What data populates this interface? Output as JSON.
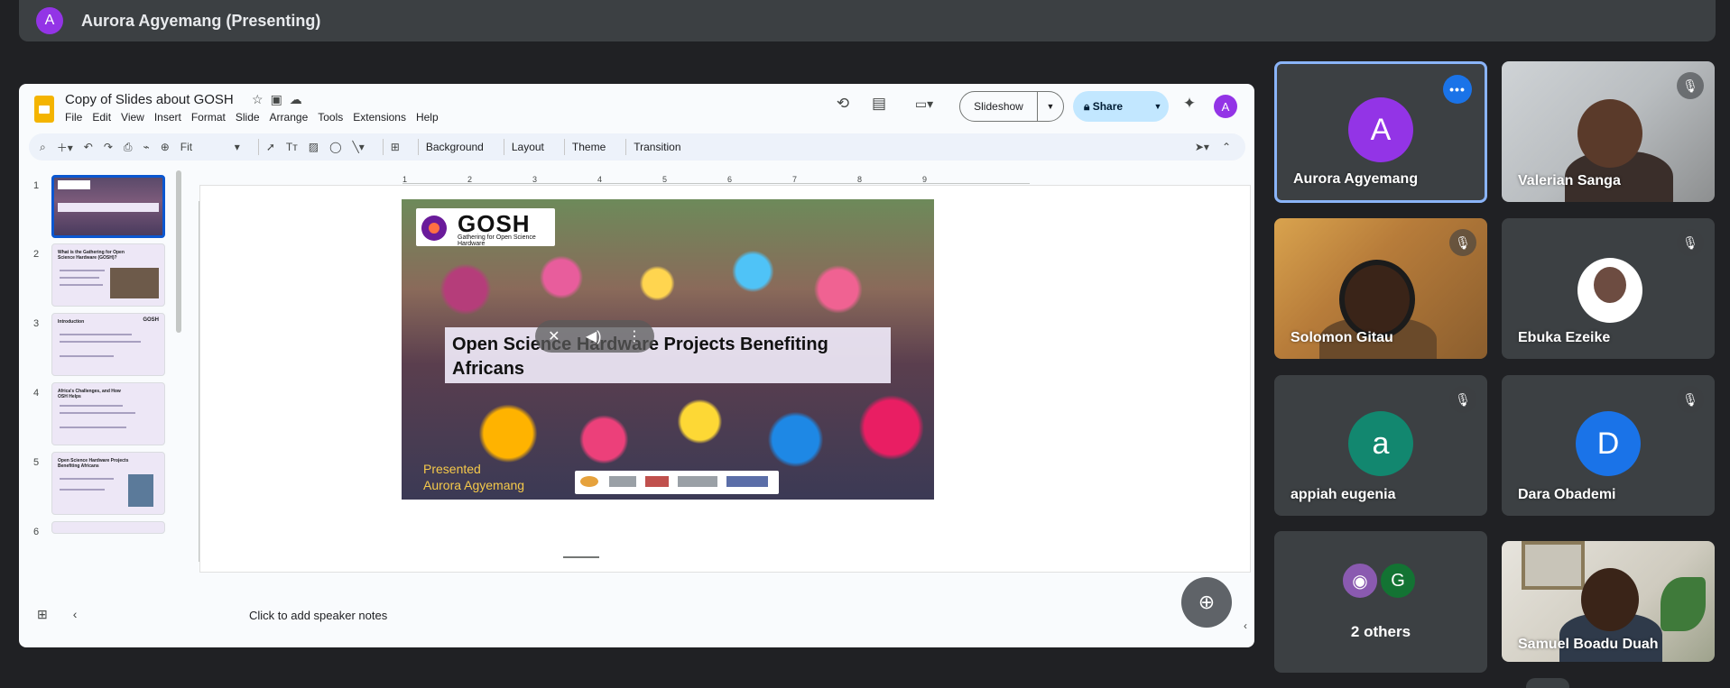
{
  "meeting": {
    "presenter_label": "Aurora Agyemang (Presenting)",
    "presenter_initial": "A"
  },
  "slides_app": {
    "doc_title": "Copy of Slides about GOSH",
    "menu": [
      "File",
      "Edit",
      "View",
      "Insert",
      "Format",
      "Slide",
      "Arrange",
      "Tools",
      "Extensions",
      "Help"
    ],
    "slideshow_label": "Slideshow",
    "share_label": "Share",
    "account_initial": "A",
    "zoom": "Fit",
    "toolbar_text": [
      "Background",
      "Layout",
      "Theme",
      "Transition"
    ],
    "ruler_ticks": [
      "1",
      "2",
      "3",
      "4",
      "5",
      "6",
      "7",
      "8",
      "9"
    ],
    "speaker_notes_placeholder": "Click to add speaker notes",
    "thumbnails": [
      {
        "num": "1",
        "title": "Open Science Hardware Projects Benefiting Africans",
        "selected": true
      },
      {
        "num": "2",
        "title": "What is the Gathering for Open Science Hardware (GOSH)?",
        "selected": false
      },
      {
        "num": "3",
        "title": "Introduction",
        "selected": false
      },
      {
        "num": "4",
        "title": "Africa's Challenges, and How OSH Helps",
        "selected": false
      },
      {
        "num": "5",
        "title": "Open Science Hardware Projects Benefiting Africans",
        "selected": false
      },
      {
        "num": "6",
        "title": "",
        "selected": false
      }
    ],
    "slide": {
      "logo_text": "GOSH",
      "logo_sub": "Gathering for Open Science Hardware",
      "title": "Open Science Hardware Projects Benefiting Africans",
      "presented_line1": "Presented",
      "presented_line2": "Aurora  Agyemang"
    }
  },
  "participants": [
    {
      "name": "Aurora Agyemang",
      "initial": "A",
      "color": "#9334e6",
      "active": true
    },
    {
      "name": "Valerian Sanga",
      "video": true,
      "muted": true
    },
    {
      "name": "Solomon Gitau",
      "video": true,
      "muted": true
    },
    {
      "name": "Ebuka Ezeike",
      "muted": true
    },
    {
      "name": "appiah eugenia",
      "initial": "a",
      "color": "#12876f",
      "muted": true
    },
    {
      "name": "Dara Obademi",
      "initial": "D",
      "color": "#1a73e8",
      "muted": true
    },
    {
      "name": "Samuel Boadu Duah",
      "video": true
    }
  ],
  "others": {
    "label": "2 others",
    "initial": "G",
    "color": "#137333"
  }
}
